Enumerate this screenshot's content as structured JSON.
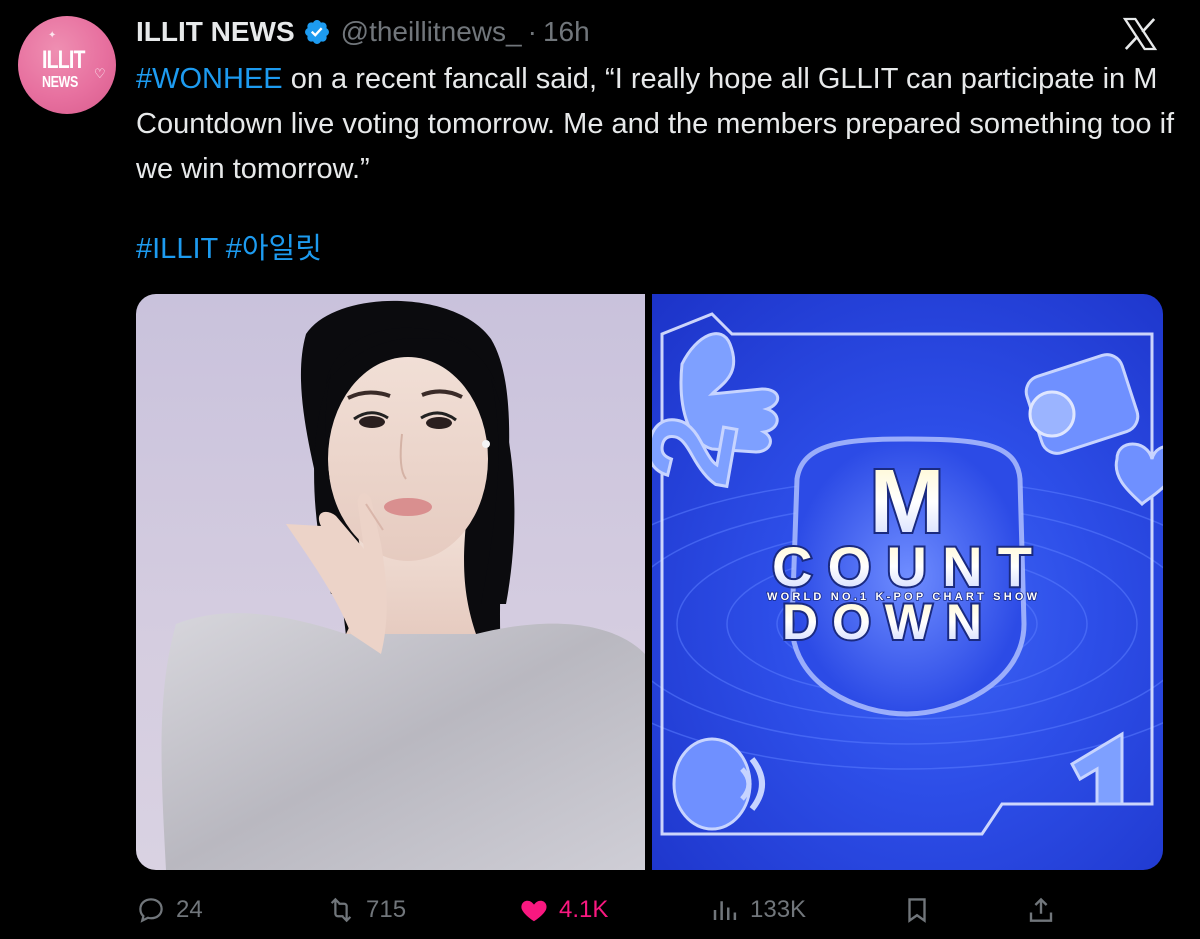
{
  "author": {
    "avatar_text_line1": "ILLIT",
    "avatar_text_line2": "NEWS",
    "display_name": "ILLIT NEWS",
    "handle": "@theillitnews_",
    "separator": "·",
    "timestamp": "16h",
    "verified_icon": "verified-badge-icon"
  },
  "tweet": {
    "hashtag_lead": "#WONHEE",
    "text": " on a recent fancall said, “I really hope all GLLIT can participate in M Countdown live voting tomorrow. Me and the members prepared something too if we win tomorrow.”",
    "hashtags": "#ILLIT #아일릿"
  },
  "media": {
    "left": {
      "description_icon": "photo-icon"
    },
    "right": {
      "logo_letter": "M",
      "logo_line1": "COUNT",
      "logo_subtitle": "WORLD NO.1 K-POP CHART SHOW",
      "logo_line2": "DOWN"
    }
  },
  "actions": {
    "replies": "24",
    "reposts": "715",
    "likes": "4.1K",
    "views": "133K"
  },
  "colors": {
    "background": "#000000",
    "text": "#e7e9ea",
    "muted": "#71767b",
    "link": "#1d9bf0",
    "like": "#f91880",
    "avatar": "#e7709f"
  }
}
